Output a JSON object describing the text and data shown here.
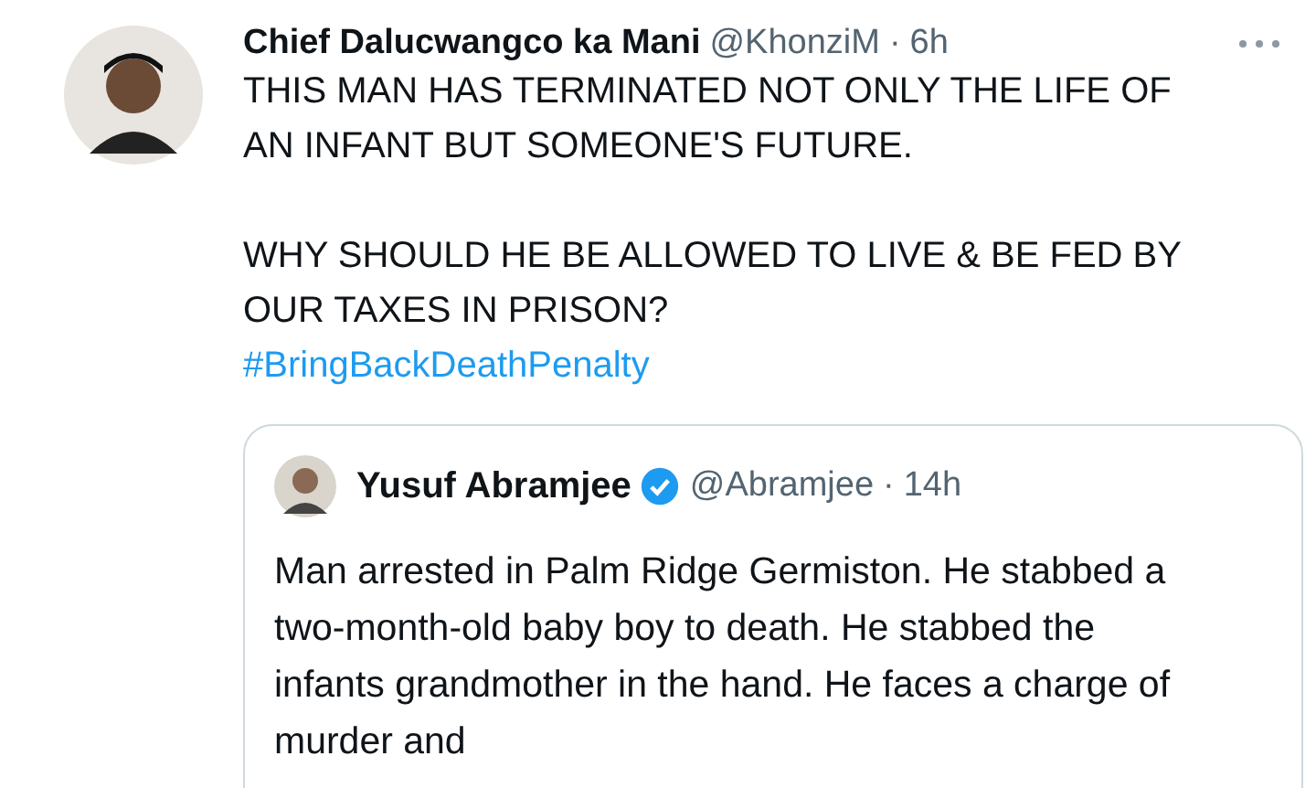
{
  "tweet": {
    "name": "Chief Dalucwangco ka Mani",
    "handle": "@KhonziM",
    "separator": "·",
    "time": "6h",
    "paragraphs": [
      "THIS MAN HAS TERMINATED NOT ONLY THE LIFE OF AN INFANT BUT SOMEONE'S FUTURE.",
      "WHY SHOULD HE BE ALLOWED TO LIVE & BE FED BY OUR TAXES IN PRISON?"
    ],
    "hashtag": "#BringBackDeathPenalty"
  },
  "quote": {
    "name": "Yusuf Abramjee",
    "verified": true,
    "handle": "@Abramjee",
    "separator": "·",
    "time": "14h",
    "text": "Man arrested in Palm Ridge Germiston. He stabbed a two-month-old baby boy to death. He stabbed the infants grandmother in the hand. He faces a charge of murder and"
  }
}
